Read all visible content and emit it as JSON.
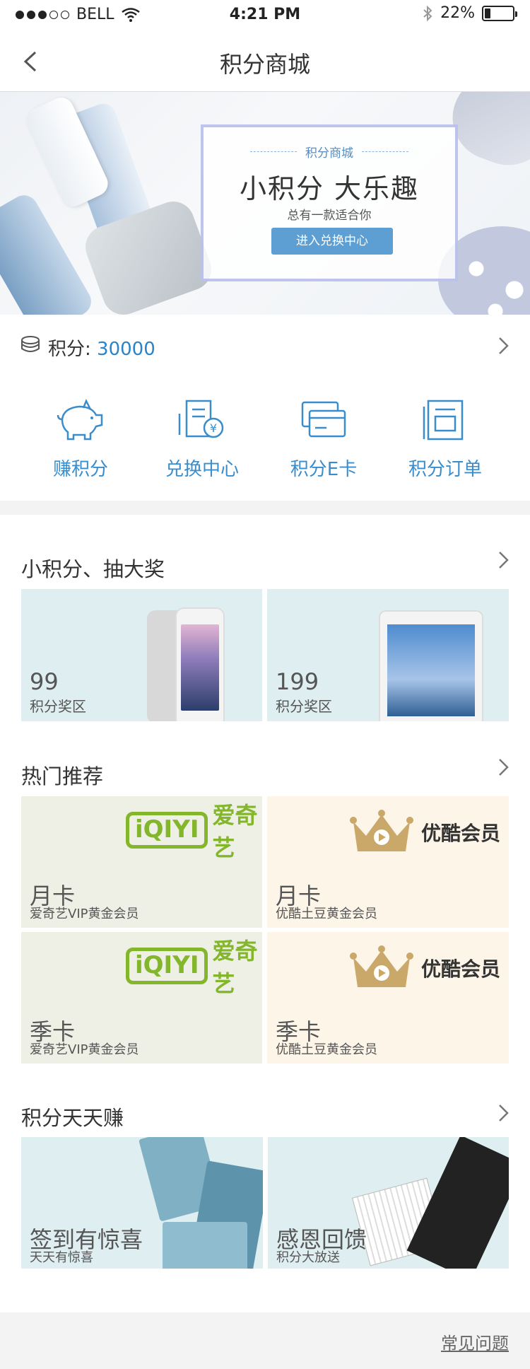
{
  "status_bar": {
    "carrier": "BELL",
    "time": "4:21 PM",
    "battery": "22%",
    "battery_level": 0.22,
    "signal_bars": 3
  },
  "nav": {
    "title": "积分商城"
  },
  "banner": {
    "kicker": "积分商城",
    "headline": "小积分 大乐趣",
    "subline": "总有一款适合你",
    "cta": "进入兑换中心"
  },
  "points": {
    "label": "积分: ",
    "value": "30000"
  },
  "quick_actions": [
    {
      "label": "赚积分",
      "icon": "piggy-bank-icon"
    },
    {
      "label": "兑换中心",
      "icon": "exchange-center-icon"
    },
    {
      "label": "积分E卡",
      "icon": "e-card-icon"
    },
    {
      "label": "积分订单",
      "icon": "order-list-icon"
    }
  ],
  "sections": {
    "lottery": {
      "title": "小积分、抽大奖",
      "tiles": [
        {
          "big": "99",
          "sub": "积分奖区"
        },
        {
          "big": "199",
          "sub": "积分奖区"
        }
      ]
    },
    "hot": {
      "title": "热门推荐",
      "tiles": [
        {
          "big": "月卡",
          "sub": "爱奇艺VIP黄金会员",
          "brand": "爱奇艺",
          "logo": "iQIYI"
        },
        {
          "big": "月卡",
          "sub": "优酷土豆黄金会员",
          "brand": "优酷会员"
        },
        {
          "big": "季卡",
          "sub": "爱奇艺VIP黄金会员",
          "brand": "爱奇艺",
          "logo": "iQIYI"
        },
        {
          "big": "季卡",
          "sub": "优酷土豆黄金会员",
          "brand": "优酷会员"
        }
      ]
    },
    "earn": {
      "title": "积分天天赚",
      "tiles": [
        {
          "big": "签到有惊喜",
          "sub": "天天有惊喜"
        },
        {
          "big": "感恩回馈",
          "sub": "积分大放送"
        }
      ]
    }
  },
  "footer": {
    "faq": "常见问题"
  },
  "colors": {
    "accent": "#3a8dcc",
    "iqiyi_green": "#83b62a",
    "youku_gold": "#c9a86a",
    "tile_blue": "#dfeef0",
    "tile_green": "#eef0e6",
    "tile_cream": "#fdf5e8"
  }
}
